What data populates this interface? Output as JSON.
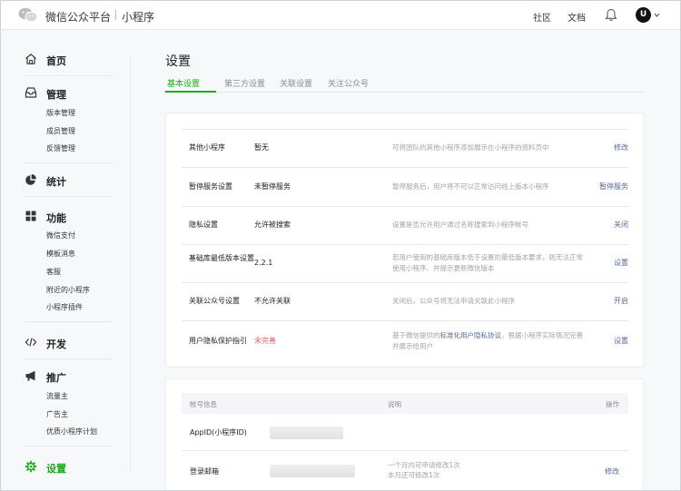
{
  "header": {
    "brand": "微信公众平台",
    "product": "小程序",
    "links": [
      "社区",
      "文档"
    ],
    "avatar_letter": "U"
  },
  "sidebar": {
    "sections": [
      {
        "label": "首页",
        "icon": "home-icon",
        "items": []
      },
      {
        "label": "管理",
        "icon": "inbox-icon",
        "items": [
          "版本管理",
          "成员管理",
          "反馈管理"
        ]
      },
      {
        "label": "统计",
        "icon": "pie-chart-icon",
        "items": []
      },
      {
        "label": "功能",
        "icon": "grid-icon",
        "items": [
          "微信支付",
          "模板消息",
          "客服",
          "附近的小程序",
          "小程序插件"
        ]
      },
      {
        "label": "开发",
        "icon": "code-icon",
        "items": []
      },
      {
        "label": "推广",
        "icon": "megaphone-icon",
        "items": [
          "流量主",
          "广告主",
          "优质小程序计划"
        ]
      },
      {
        "label": "设置",
        "icon": "gear-icon",
        "items": [],
        "active": true
      }
    ]
  },
  "page": {
    "title": "设置",
    "tabs": [
      "基本设置",
      "第三方设置",
      "关联设置",
      "关注公众号"
    ],
    "active_tab": 0
  },
  "settings": [
    {
      "label": "其他小程序",
      "value": "暂无",
      "desc": "可将团队的其他小程序添加展示在小程序的资料页中",
      "action": "修改"
    },
    {
      "label": "暂停服务设置",
      "value": "未暂停服务",
      "desc": "暂停服务后，用户将不可以正常访问线上版本小程序",
      "action": "暂停服务"
    },
    {
      "label": "隐私设置",
      "value": "允许被搜索",
      "desc": "设置是否允许用户通过名称搜索到小程序帐号",
      "action": "关闭"
    },
    {
      "label": "基础库最低版本设置",
      "value": "2.2.1",
      "desc": "若用户使用的基础库版本低于设置的最低版本要求，则无法正常使用小程序、并提示更新微信版本",
      "action": "设置"
    },
    {
      "label": "关联公众号设置",
      "value": "不允许关联",
      "desc": "关闭后，公众号将无法申请关联此小程序",
      "action": "开启"
    },
    {
      "label": "用户隐私保护指引",
      "value": "未完善",
      "desc_prefix": "基于微信提供的",
      "desc_link": "标准化用户隐私协议",
      "desc_suffix": "，根据小程序实际情况完善并展示给用户",
      "action": "设置"
    }
  ],
  "account": {
    "headers": [
      "帐号信息",
      "说明",
      "操作"
    ],
    "rows": [
      {
        "label": "AppID(小程序ID)",
        "desc": [],
        "action": ""
      },
      {
        "label": "登录邮箱",
        "desc": [
          "一个月内可申请修改1次",
          "本月还可修改1次"
        ],
        "action": "修改"
      }
    ]
  },
  "colors": {
    "accent": "#1aad19",
    "link": "#576b95",
    "warn": "#e15f63"
  }
}
